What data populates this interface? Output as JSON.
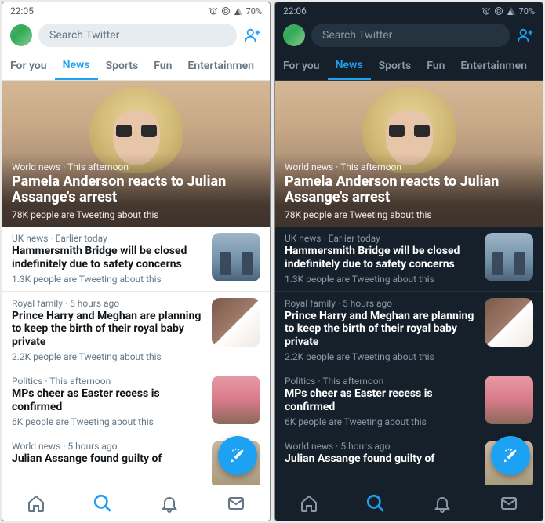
{
  "screens": {
    "light": {
      "time": "22:05",
      "battery": "70%"
    },
    "dark": {
      "time": "22:06",
      "battery": "70%"
    }
  },
  "search": {
    "placeholder": "Search Twitter"
  },
  "tabs": {
    "for_you": "For you",
    "news": "News",
    "sports": "Sports",
    "fun": "Fun",
    "entertainment": "Entertainment",
    "entertainment_truncated": "Entertainmen"
  },
  "hero": {
    "meta_category": "World news",
    "meta_time": "This afternoon",
    "title": "Pamela Anderson reacts to Julian Assange's arrest",
    "sub": "78K people are Tweeting about this"
  },
  "stories": [
    {
      "meta_category": "UK news",
      "meta_time": "Earlier today",
      "title": "Hammersmith Bridge will be closed indefinitely due to safety concerns",
      "sub": "1.3K people are Tweeting about this"
    },
    {
      "meta_category": "Royal family",
      "meta_time": "5 hours ago",
      "title": "Prince Harry and Meghan are planning to keep the birth of their royal baby private",
      "sub": "2.2K people are Tweeting about this"
    },
    {
      "meta_category": "Politics",
      "meta_time": "This afternoon",
      "title": "MPs cheer as Easter recess is confirmed",
      "sub": "6K people are Tweeting about this"
    },
    {
      "meta_category": "World news",
      "meta_time": "5 hours ago",
      "title_truncated": "Julian Assange found guilty of",
      "sub": ""
    }
  ],
  "colors": {
    "accent": "#1da1f2"
  }
}
